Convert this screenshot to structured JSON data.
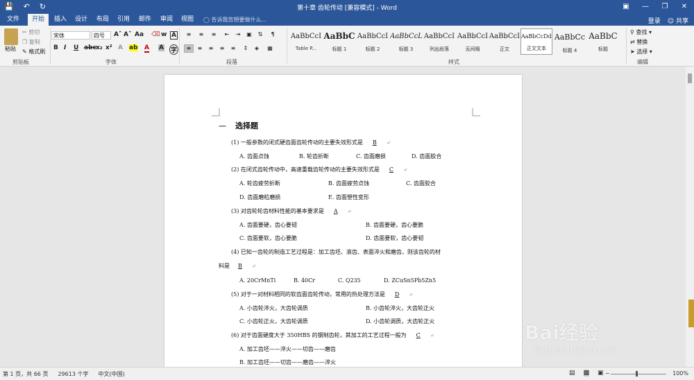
{
  "window": {
    "title": "第十章 齿轮传动 [兼容模式] - Word",
    "qat": [
      "save-icon",
      "undo-icon",
      "redo-icon"
    ],
    "win_buttons": [
      "ribbon-display-icon",
      "minimize-icon",
      "restore-icon",
      "close-icon"
    ]
  },
  "tabs": [
    {
      "label": "文件"
    },
    {
      "label": "开始"
    },
    {
      "label": "插入"
    },
    {
      "label": "设计"
    },
    {
      "label": "布局"
    },
    {
      "label": "引用"
    },
    {
      "label": "邮件"
    },
    {
      "label": "审阅"
    },
    {
      "label": "视图"
    }
  ],
  "active_tab": "开始",
  "tell_me": "告诉我您想要做什么...",
  "account": {
    "login": "登录",
    "share": "共享"
  },
  "clipboard": {
    "paste": "粘贴",
    "cut": "剪切",
    "copy": "复制",
    "painter": "格式刷",
    "group": "剪贴板"
  },
  "font": {
    "name": "宋体",
    "size": "四号",
    "group": "字体"
  },
  "paragraph": {
    "group": "段落"
  },
  "styles": {
    "group": "样式",
    "items": [
      {
        "preview": "AaBbCcI",
        "name": "Table P..."
      },
      {
        "preview": "AaBbC",
        "name": "标题 1"
      },
      {
        "preview": "AaBbCcI",
        "name": "标题 2"
      },
      {
        "preview": "AaBbCcL",
        "name": "标题 3"
      },
      {
        "preview": "AaBbCcI",
        "name": "列出段落"
      },
      {
        "preview": "AaBbCcI",
        "name": "无间隔"
      },
      {
        "preview": "AaBbCcI",
        "name": "正文"
      },
      {
        "preview": "AaBbCcDdI",
        "name": "正文文本"
      },
      {
        "preview": "AaBbCc",
        "name": "标题 4"
      },
      {
        "preview": "AaBbC",
        "name": "标题"
      }
    ]
  },
  "editing": {
    "find": "查找",
    "replace": "替换",
    "select": "选择",
    "group": "编辑"
  },
  "document": {
    "heading_num": "一",
    "heading": "选择题",
    "questions": [
      {
        "q": "(1) 一般参数的闭式硬齿面齿轮传动的主要失效形式是",
        "ans": "B",
        "opts": [
          "A. 齿面点蚀",
          "B. 轮齿折断",
          "C. 齿面磨损",
          "D. 齿面胶合"
        ]
      },
      {
        "q": "(2) 在闭式齿轮传动中，高速重载齿轮传动的主要失效形式是",
        "ans": "C",
        "opts": [
          "A. 轮齿疲劳折断",
          "B. 齿面疲劳点蚀",
          "C. 齿面胶合",
          "D. 齿面磨粒磨损",
          "E. 齿面塑性变形"
        ]
      },
      {
        "q": "(3) 对齿轮轮齿材料性能的基本要求是",
        "ans": "A",
        "opts": [
          "A. 齿面要硬，齿心要韧",
          "B. 齿面要硬，齿心要脆",
          "C. 齿面要软，齿心要脆",
          "D. 齿面要软，齿心要韧"
        ]
      },
      {
        "q": "(4) 已知一齿轮的制造工艺过程是：加工齿坯、滚齿、表面淬火和磨齿，则该齿轮的材",
        "q2": "料是",
        "ans": "B",
        "opts": [
          "A. 20CrMnTi",
          "B. 40Cr",
          "C. Q235",
          "D. ZCuSn5Pb5Zn5"
        ]
      },
      {
        "q": "(5) 对于一对材料相同的软齿面齿轮传动，常用的热处理方法是",
        "ans": "D",
        "opts": [
          "A. 小齿轮淬火，大齿轮调质",
          "B. 小齿轮淬火，大齿轮正火",
          "C. 小齿轮正火，大齿轮调质",
          "D. 小齿轮调质，大齿轮正火"
        ]
      },
      {
        "q": "(6) 对于齿面硬度大于 350HBS 的钢制齿轮，其加工的工艺过程一般为",
        "ans": "C",
        "opts": [
          "A. 加工齿坯——淬火——切齿——磨齿",
          "B. 加工齿坯——切齿——磨齿——淬火"
        ]
      }
    ]
  },
  "status": {
    "page": "第 1 页，共 66 页",
    "words": "29613 个字",
    "lang": "中文(中国)",
    "zoom": "100%"
  },
  "watermark": {
    "brand": "Bai经验",
    "url": "jingyan.baidu.com"
  }
}
